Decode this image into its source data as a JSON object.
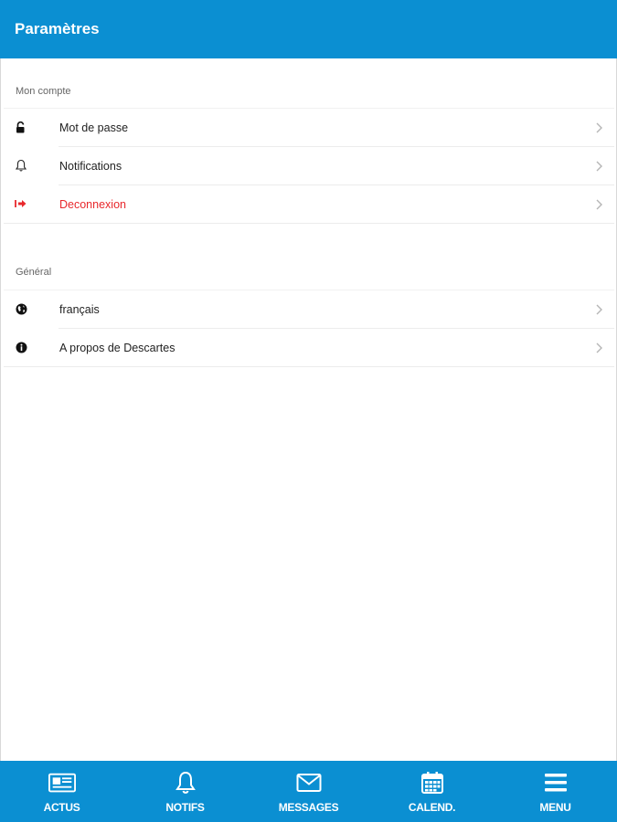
{
  "header": {
    "title": "Paramètres"
  },
  "sections": [
    {
      "label": "Mon compte",
      "items": [
        {
          "label": "Mot de passe",
          "icon": "lock-icon"
        },
        {
          "label": "Notifications",
          "icon": "bell-icon"
        },
        {
          "label": "Deconnexion",
          "icon": "sign-out-icon"
        }
      ]
    },
    {
      "label": "Général",
      "items": [
        {
          "label": "français",
          "icon": "globe-icon"
        },
        {
          "label": "A propos de  Descartes",
          "icon": "info-icon"
        }
      ]
    }
  ],
  "tabbar": [
    {
      "label": "ACTUS",
      "icon": "newspaper-icon"
    },
    {
      "label": "NOTIFS",
      "icon": "bell-icon"
    },
    {
      "label": "MESSAGES",
      "icon": "envelope-icon"
    },
    {
      "label": "CALEND.",
      "icon": "calendar-icon"
    },
    {
      "label": "MENU",
      "icon": "hamburger-icon"
    }
  ],
  "colors": {
    "primary": "#0b8fd2",
    "danger": "#e8282c"
  }
}
